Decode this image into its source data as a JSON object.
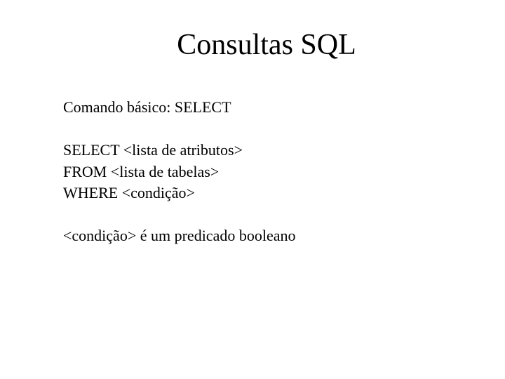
{
  "title": "Consultas SQL",
  "section1": {
    "line1": "Comando básico: SELECT"
  },
  "section2": {
    "line1": "SELECT <lista de atributos>",
    "line2": "FROM <lista de tabelas>",
    "line3": "WHERE <condição>"
  },
  "section3": {
    "line1": "<condição> é um predicado booleano"
  }
}
